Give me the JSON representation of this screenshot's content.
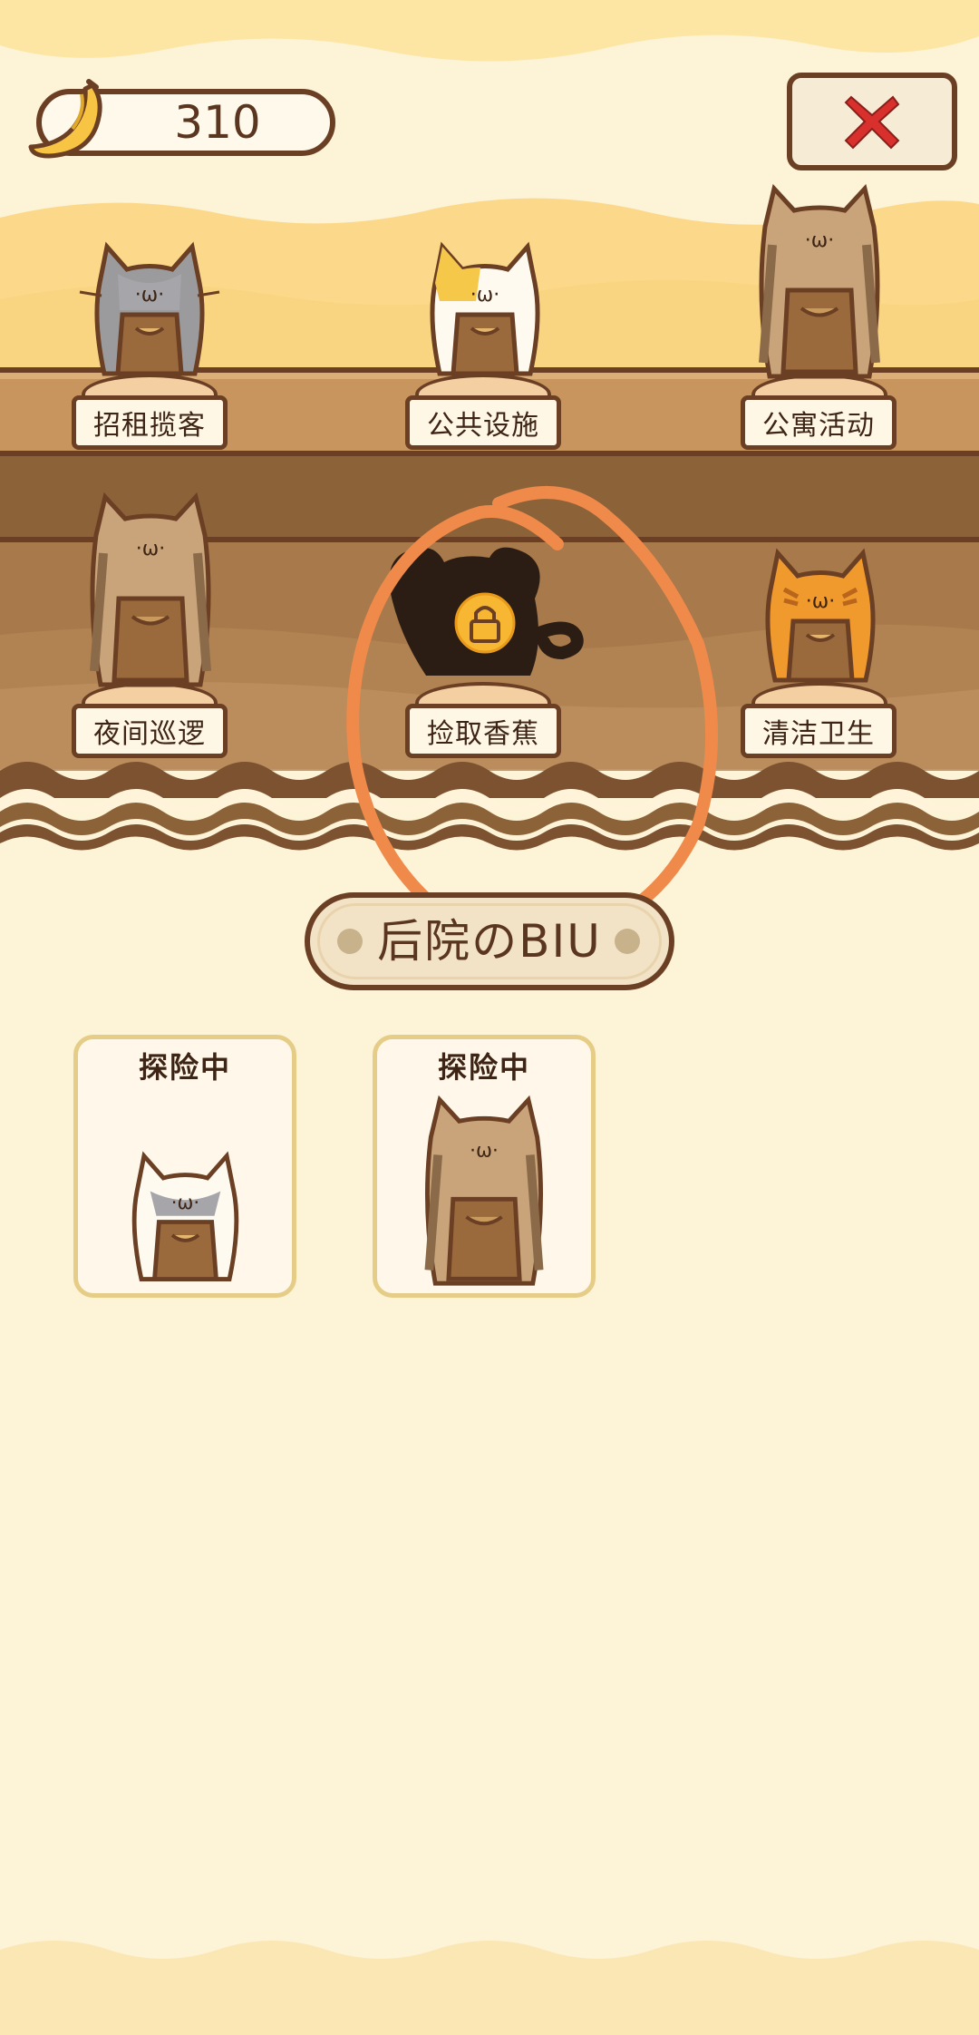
{
  "header": {
    "banana_count": "310",
    "banana_icon": "banana-icon",
    "close_icon": "close-x-icon"
  },
  "colors": {
    "background": "#fdf3d6",
    "wood_light": "#c8955e",
    "wood_dark": "#8c6238",
    "outline": "#6b3f24",
    "close_red": "#d8302c",
    "annotation_orange": "#f08a4b",
    "card_border": "#e6cd87"
  },
  "shelf_top": [
    {
      "label": "招租揽客",
      "cat": "gray-white-cat"
    },
    {
      "label": "公共设施",
      "cat": "calico-cat"
    },
    {
      "label": "公寓活动",
      "cat": "tabby-cat"
    }
  ],
  "shelf_bottom": [
    {
      "label": "夜间巡逻",
      "cat": "tabby-cat"
    },
    {
      "label": "捡取香蕉",
      "cat": "locked-silhouette-cat",
      "locked": true
    },
    {
      "label": "清洁卫生",
      "cat": "orange-tabby-cat"
    }
  ],
  "section": {
    "title": "后院のBIU"
  },
  "backyard_cards": [
    {
      "status": "探险中",
      "cat": "gray-white-cat"
    },
    {
      "status": "探险中",
      "cat": "tabby-cat"
    }
  ]
}
